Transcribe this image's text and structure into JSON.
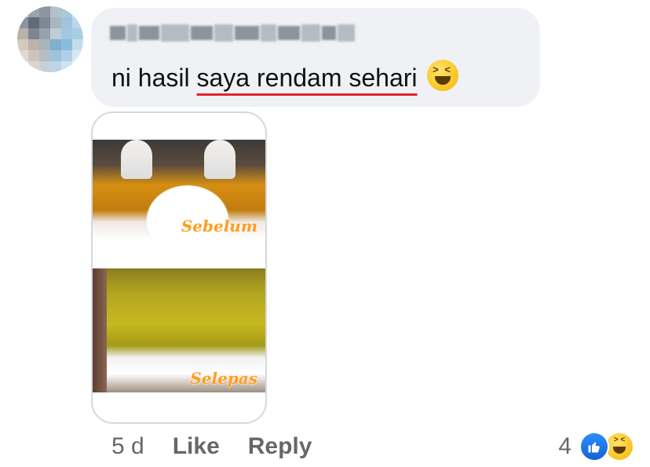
{
  "comment": {
    "text_prefix": "ni hasil ",
    "text_underlined": "saya rendam sehari",
    "emoji": "laughing-face-icon"
  },
  "photo": {
    "before_label": "Sebelum",
    "after_label": "Selepas"
  },
  "meta": {
    "time": "5 d",
    "like_label": "Like",
    "reply_label": "Reply"
  },
  "reactions": {
    "count": "4",
    "icons": [
      "like-icon",
      "haha-icon"
    ]
  },
  "colors": {
    "bubble": "#eff1f4",
    "meta_text": "#65676b",
    "underline": "#e0262e",
    "label_orange": "#ff9d1f",
    "like_blue": "#1877f2"
  }
}
